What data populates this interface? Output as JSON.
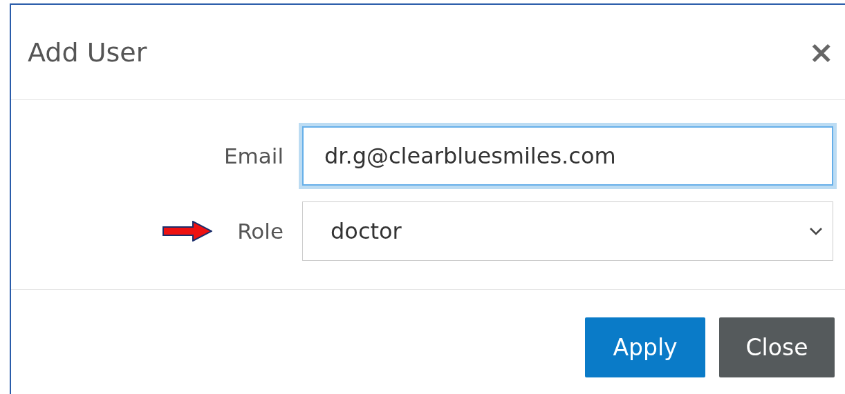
{
  "dialog": {
    "title": "Add User",
    "close": "×"
  },
  "fields": [
    {
      "label": "Email",
      "kind": "text",
      "value": "dr.g@clearbluesmiles.com",
      "focused": true,
      "annotated": false
    },
    {
      "label": "Role",
      "kind": "select",
      "value": "doctor",
      "focused": false,
      "annotated": true
    }
  ],
  "buttons": [
    {
      "label": "Apply",
      "kind": "primary"
    },
    {
      "label": "Close",
      "kind": "secondary"
    }
  ]
}
